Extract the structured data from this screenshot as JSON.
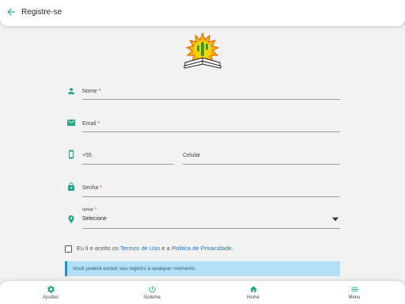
{
  "header": {
    "title": "Registre-se"
  },
  "colors": {
    "accent": "#26a688",
    "link": "#1a73c9",
    "info_bg": "#b3e0f5",
    "required": "#d32f2f"
  },
  "form": {
    "name_label": "Nome",
    "email_label": "Email",
    "phone_prefix": "+55",
    "phone_label": "Celular",
    "password_label": "Senha",
    "church_label": "Igreja",
    "church_value": "Selecione",
    "required_mark": "*"
  },
  "terms": {
    "prefix": "Eu li e aceito os ",
    "terms_link": "Termos de Uso",
    "middle": " e a ",
    "privacy_link": "Politica de Privacidade",
    "suffix": "."
  },
  "info_message": "Você poderá excluir seu registro a qualquer momento.",
  "nav": {
    "items": [
      {
        "label": "Ajustes",
        "icon": "gear-icon"
      },
      {
        "label": "Sistema",
        "icon": "power-icon"
      },
      {
        "label": "Home",
        "icon": "home-icon"
      },
      {
        "label": "Menu",
        "icon": "menu-icon"
      }
    ]
  }
}
